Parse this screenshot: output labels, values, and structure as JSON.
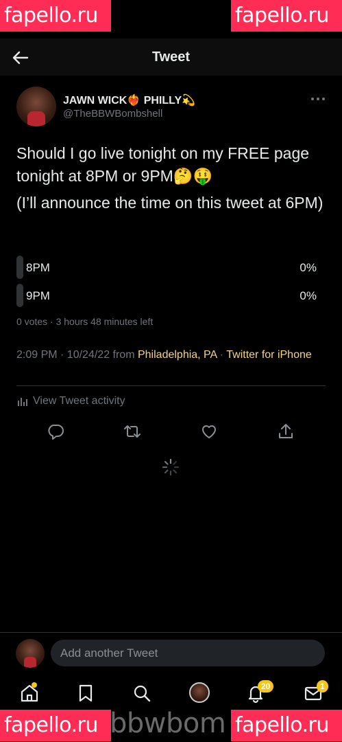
{
  "watermark": {
    "text": "fapello.ru",
    "bottom_text": "bbwbom"
  },
  "header": {
    "title": "Tweet"
  },
  "tweet": {
    "display_name": "JAWN WICK❤️‍🔥 PHILLY💫",
    "handle": "@TheBBWBombshell",
    "text_line1": "Should I go live tonight on my FREE page tonight at 8PM or 9PM🤔🤑",
    "text_line2": "(I’ll announce the time on this tweet at 6PM)",
    "poll": {
      "options": [
        {
          "label": "8PM",
          "percent_text": "0%",
          "percent": 0
        },
        {
          "label": "9PM",
          "percent_text": "0%",
          "percent": 0
        }
      ],
      "meta": "0 votes · 3 hours 48 minutes left"
    },
    "time": "2:09 PM · 10/24/22 from ",
    "location": "Philadelphia, PA",
    "separator": " · ",
    "source": "Twitter for iPhone",
    "activity_label": "View Tweet activity"
  },
  "reply": {
    "placeholder": "Add another Tweet"
  },
  "tabbar": {
    "notifications_badge": "20",
    "messages_badge": "1"
  },
  "colors": {
    "background": "#000000",
    "accent_link": "#f4d58d",
    "badge": "#f5c518",
    "watermark": "#ff2d55"
  },
  "icons": [
    "back-arrow-icon",
    "more-icon",
    "activity-icon",
    "reply-icon",
    "retweet-icon",
    "like-icon",
    "share-icon",
    "spinner-icon",
    "home-icon",
    "bookmark-icon",
    "search-icon",
    "bell-icon",
    "mail-icon"
  ]
}
